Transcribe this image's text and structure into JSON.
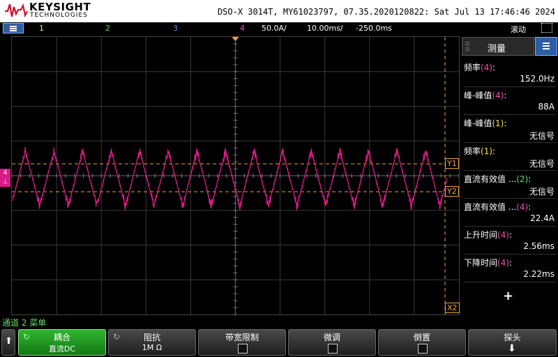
{
  "header": {
    "brand": "KEYSIGHT",
    "brand_sub": "TECHNOLOGIES",
    "instrument_info": "DSO-X 3014T, MY61023797, 07.35.2020120822: Sat Jul 13 17:46:46 2024"
  },
  "channel_bar": {
    "ch1": "1",
    "ch2": "2",
    "ch3": "3",
    "ch4": "4",
    "ch4_scale": "50.0A/",
    "timebase": "10.00ms/",
    "delay": "-250.0ms",
    "mode": "滚动"
  },
  "plot": {
    "cursor_y1": "Y1",
    "cursor_y2": "Y2",
    "cursor_x2": "X2",
    "channel_marker": "4",
    "waveform": {
      "cycles": 15.2,
      "color": "#d81b86"
    }
  },
  "sidebar": {
    "title": "测量",
    "measurements": [
      {
        "label": "频率",
        "channel": "(4)",
        "suffix": ":",
        "value": "152.0Hz",
        "color": "ch4"
      },
      {
        "label": "峰-峰值",
        "channel": "(4)",
        "suffix": ":",
        "value": "88A",
        "color": "ch4"
      },
      {
        "label": "峰-峰值",
        "channel": "(1)",
        "suffix": ":",
        "value": "无信号",
        "color": "ch1"
      },
      {
        "label": "频率",
        "channel": "(1)",
        "suffix": ":",
        "value": "无信号",
        "color": "ch1"
      },
      {
        "label": "直流有效值 ...",
        "channel": "(2)",
        "suffix": ":",
        "value": "无信号",
        "color": "ch2"
      },
      {
        "label": "直流有效值 ...",
        "channel": "(4)",
        "suffix": ":",
        "value": "22.4A",
        "color": "ch4"
      },
      {
        "label": "上升时间",
        "channel": "(4)",
        "suffix": ":",
        "value": "2.56ms",
        "color": "ch4"
      },
      {
        "label": "下降时间",
        "channel": "(4)",
        "suffix": ":",
        "value": "2.22ms",
        "color": "ch4"
      }
    ],
    "add": "+"
  },
  "softbar": {
    "title": "通道 2 菜单",
    "keys": [
      {
        "label": "耦合",
        "value": "直流DC"
      },
      {
        "label": "阻抗",
        "value": "1M Ω"
      },
      {
        "label": "带宽限制",
        "value": ""
      },
      {
        "label": "微调",
        "value": ""
      },
      {
        "label": "倒置",
        "value": ""
      },
      {
        "label": "探头",
        "value": ""
      }
    ]
  },
  "colors": {
    "accent_blue": "#2c5ea8",
    "cursor": "#f1a33b",
    "ch4": "#d81b86",
    "ch2": "#5fdc5f",
    "ch1": "#f4e84a"
  }
}
